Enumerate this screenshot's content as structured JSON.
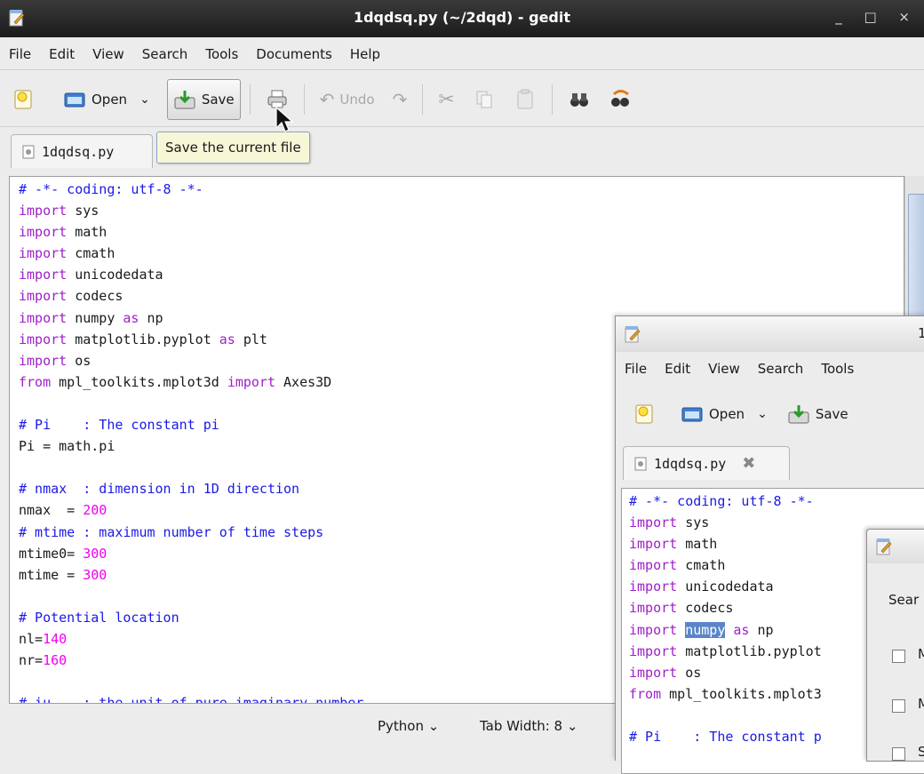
{
  "main_window": {
    "title": "1dqdsq.py (~/2dqd) - gedit",
    "window_controls": "_ □ ×",
    "menu": [
      "File",
      "Edit",
      "View",
      "Search",
      "Tools",
      "Documents",
      "Help"
    ],
    "toolbar": {
      "open_label": "Open",
      "save_label": "Save",
      "undo_label": "Undo"
    },
    "tab_label": "1dqdsq.py",
    "tooltip": "Save the current file",
    "status": {
      "language": "Python",
      "tab_width": "Tab Width: 8"
    }
  },
  "code_lines": [
    [
      {
        "t": "# -*- coding: utf-8 -*-",
        "c": "c"
      }
    ],
    [
      {
        "t": "import",
        "c": "k"
      },
      {
        "t": " sys",
        "c": ""
      }
    ],
    [
      {
        "t": "import",
        "c": "k"
      },
      {
        "t": " math",
        "c": ""
      }
    ],
    [
      {
        "t": "import",
        "c": "k"
      },
      {
        "t": " cmath",
        "c": ""
      }
    ],
    [
      {
        "t": "import",
        "c": "k"
      },
      {
        "t": " unicodedata",
        "c": ""
      }
    ],
    [
      {
        "t": "import",
        "c": "k"
      },
      {
        "t": " codecs",
        "c": ""
      }
    ],
    [
      {
        "t": "import",
        "c": "k"
      },
      {
        "t": " numpy ",
        "c": ""
      },
      {
        "t": "as",
        "c": "k"
      },
      {
        "t": " np",
        "c": ""
      }
    ],
    [
      {
        "t": "import",
        "c": "k"
      },
      {
        "t": " matplotlib.pyplot ",
        "c": ""
      },
      {
        "t": "as",
        "c": "k"
      },
      {
        "t": " plt",
        "c": ""
      }
    ],
    [
      {
        "t": "import",
        "c": "k"
      },
      {
        "t": " os",
        "c": ""
      }
    ],
    [
      {
        "t": "from",
        "c": "k"
      },
      {
        "t": " mpl_toolkits.mplot3d ",
        "c": ""
      },
      {
        "t": "import",
        "c": "k"
      },
      {
        "t": " Axes3D",
        "c": ""
      }
    ],
    [
      {
        "t": "",
        "c": ""
      }
    ],
    [
      {
        "t": "# Pi    : The constant pi",
        "c": "c"
      }
    ],
    [
      {
        "t": "Pi = math.pi",
        "c": ""
      }
    ],
    [
      {
        "t": "",
        "c": ""
      }
    ],
    [
      {
        "t": "# nmax  : dimension in 1D direction",
        "c": "c"
      }
    ],
    [
      {
        "t": "nmax  = ",
        "c": ""
      },
      {
        "t": "200",
        "c": "n"
      }
    ],
    [
      {
        "t": "# mtime : maximum number of time steps",
        "c": "c"
      }
    ],
    [
      {
        "t": "mtime0= ",
        "c": ""
      },
      {
        "t": "300",
        "c": "n"
      }
    ],
    [
      {
        "t": "mtime = ",
        "c": ""
      },
      {
        "t": "300",
        "c": "n"
      }
    ],
    [
      {
        "t": "",
        "c": ""
      }
    ],
    [
      {
        "t": "# Potential location",
        "c": "c"
      }
    ],
    [
      {
        "t": "nl=",
        "c": ""
      },
      {
        "t": "140",
        "c": "n"
      }
    ],
    [
      {
        "t": "nr=",
        "c": ""
      },
      {
        "t": "160",
        "c": "n"
      }
    ],
    [
      {
        "t": "",
        "c": ""
      }
    ],
    [
      {
        "t": "# iu    : the unit of pure imaginary number",
        "c": "c"
      }
    ]
  ],
  "window2": {
    "title_fragment": "1",
    "menu": [
      "File",
      "Edit",
      "View",
      "Search",
      "Tools"
    ],
    "toolbar": {
      "open_label": "Open",
      "save_label": "Save"
    },
    "tab_label": "1dqdsq.py",
    "code_lines": [
      [
        {
          "t": "# -*- coding: utf-8 -*-",
          "c": "c"
        }
      ],
      [
        {
          "t": "import",
          "c": "k"
        },
        {
          "t": " sys",
          "c": ""
        }
      ],
      [
        {
          "t": "import",
          "c": "k"
        },
        {
          "t": " math",
          "c": ""
        }
      ],
      [
        {
          "t": "import",
          "c": "k"
        },
        {
          "t": " cmath",
          "c": ""
        }
      ],
      [
        {
          "t": "import",
          "c": "k"
        },
        {
          "t": " unicodedata",
          "c": ""
        }
      ],
      [
        {
          "t": "import",
          "c": "k"
        },
        {
          "t": " codecs",
          "c": ""
        }
      ],
      [
        {
          "t": "import",
          "c": "k"
        },
        {
          "t": " ",
          "c": ""
        },
        {
          "t": "numpy",
          "c": "sel"
        },
        {
          "t": " ",
          "c": ""
        },
        {
          "t": "as",
          "c": "k"
        },
        {
          "t": " np",
          "c": ""
        }
      ],
      [
        {
          "t": "import",
          "c": "k"
        },
        {
          "t": " matplotlib.pyplot",
          "c": ""
        }
      ],
      [
        {
          "t": "import",
          "c": "k"
        },
        {
          "t": " os",
          "c": ""
        }
      ],
      [
        {
          "t": "from",
          "c": "k"
        },
        {
          "t": " mpl_toolkits.mplot3",
          "c": ""
        }
      ],
      [
        {
          "t": "",
          "c": ""
        }
      ],
      [
        {
          "t": "# Pi    : The constant p",
          "c": "c"
        }
      ]
    ]
  },
  "window3": {
    "label_fragment": "Sear",
    "checkbox_labels": [
      "M",
      "M",
      "S"
    ]
  }
}
